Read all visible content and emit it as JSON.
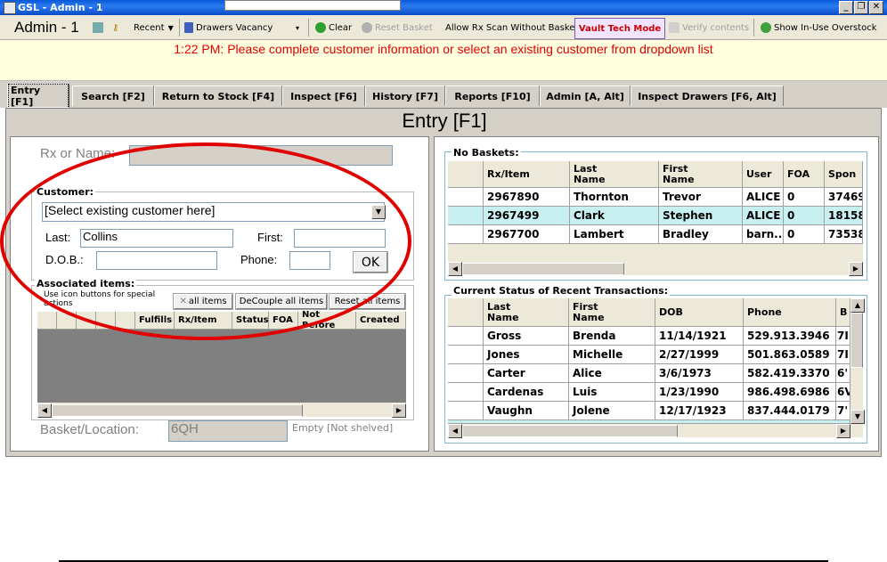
{
  "window": {
    "title": "GSL - Admin - 1"
  },
  "toolbar": {
    "user": "Admin - 1",
    "recent": "Recent",
    "drawers_vacancy": "Drawers Vacancy",
    "clear": "Clear",
    "reset_basket": "Reset Basket",
    "allow_scan": "Allow Rx Scan Without Basket",
    "vault_tech": "Vault Tech Mode",
    "verify": "Verify contents",
    "show_overstock": "Show In-Use Overstock"
  },
  "message": "1:22 PM: Please complete customer information or select an existing customer from dropdown list",
  "tabs": [
    {
      "label": "Entry [F1]"
    },
    {
      "label": "Search [F2]"
    },
    {
      "label": "Return to Stock [F4]"
    },
    {
      "label": "Inspect [F6]"
    },
    {
      "label": "History [F7]"
    },
    {
      "label": "Reports [F10]"
    },
    {
      "label": "Admin [A, Alt]"
    },
    {
      "label": "Inspect Drawers [F6, Alt]"
    }
  ],
  "page_title": "Entry [F1]",
  "entry": {
    "rx_or_name_label": "Rx or Name:",
    "rx_or_name_value": "",
    "customer_label": "Customer:",
    "customer_select": "[Select existing customer here]",
    "last_label": "Last:",
    "last_value": "Collins",
    "first_label": "First:",
    "first_value": "",
    "dob_label": "D.O.B.:",
    "dob_value": "",
    "phone_label": "Phone:",
    "phone_value": "",
    "ok": "OK",
    "associated_label": "Associated items:",
    "associated_hint": "Use icon buttons for special actions",
    "all_items": "all items",
    "decouple": "DeCouple all items",
    "reset_all": "Reset all items",
    "assoc_headers": [
      "Fulfills",
      "Rx/Item",
      "Status",
      "FOA",
      "Not Before",
      "Created"
    ],
    "basket_label": "Basket/Location:",
    "basket_value": "6QH",
    "basket_status": "Empty [Not shelved]"
  },
  "no_baskets": {
    "title": "No Baskets:",
    "headers": [
      "Rx/Item",
      "Last\nName",
      "First\nName",
      "User",
      "FOA",
      "Spon"
    ],
    "rows": [
      [
        "2967890",
        "Thornton",
        "Trevor",
        "ALICE",
        "0",
        "37469"
      ],
      [
        "2967499",
        "Clark",
        "Stephen",
        "ALICE",
        "0",
        "18158"
      ],
      [
        "2967700",
        "Lambert",
        "Bradley",
        "barn...",
        "0",
        "73538"
      ]
    ]
  },
  "recent": {
    "title": "Current Status of Recent Transactions:",
    "headers": [
      "Last\nName",
      "First\nName",
      "DOB",
      "Phone",
      "B"
    ],
    "rows": [
      [
        "Gross",
        "Brenda",
        "11/14/1921",
        "529.913.3946",
        "7I"
      ],
      [
        "Jones",
        "Michelle",
        "2/27/1999",
        "501.863.0589",
        "7I"
      ],
      [
        "Carter",
        "Alice",
        "3/6/1973",
        "582.419.3370",
        "6'"
      ],
      [
        "Cardenas",
        "Luis",
        "1/23/1990",
        "986.498.6986",
        "6V"
      ],
      [
        "Vaughn",
        "Jolene",
        "12/17/1923",
        "837.444.0179",
        "7'"
      ]
    ]
  }
}
